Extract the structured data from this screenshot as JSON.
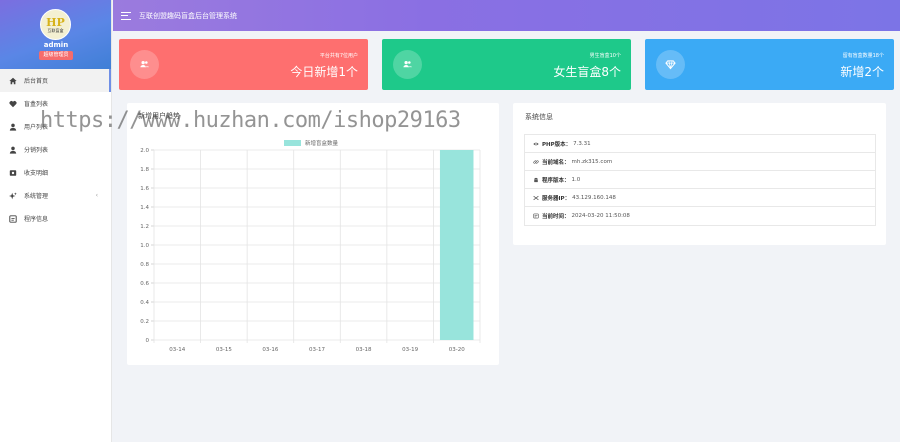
{
  "sidebar": {
    "avatar": {
      "logo_big": "HP",
      "logo_small": "互联盲盒"
    },
    "username": "admin",
    "role": "超级管理员",
    "items": [
      {
        "label": "后台首页",
        "icon": "home-icon"
      },
      {
        "label": "盲盒列表",
        "icon": "heart-icon"
      },
      {
        "label": "用户列表",
        "icon": "user-icon"
      },
      {
        "label": "分销列表",
        "icon": "user-icon"
      },
      {
        "label": "收支明细",
        "icon": "wallet-icon"
      },
      {
        "label": "系统管理",
        "icon": "sparkle-icon",
        "arrow": "‹"
      },
      {
        "label": "程序信息",
        "icon": "info-icon"
      }
    ]
  },
  "header": {
    "title": "互联创盟趣码盲盒后台管理系统"
  },
  "cards": [
    {
      "small": "平台共有7位用户",
      "big": "今日新增1个",
      "icon": "users-icon",
      "color": "#fe6f6f"
    },
    {
      "small": "男生盲盒10个",
      "big": "女生盲盒8个",
      "icon": "users-icon",
      "color": "#1ec98a"
    },
    {
      "small": "留有盲盒数量18个",
      "big": "新增2个",
      "icon": "diamond-icon",
      "color": "#3baaf5"
    }
  ],
  "chart_panel": {
    "title": "新增用户趋势"
  },
  "chart_data": {
    "type": "bar",
    "categories": [
      "03-14",
      "03-15",
      "03-16",
      "03-17",
      "03-18",
      "03-19",
      "03-20"
    ],
    "series": [
      {
        "name": "新增盲盒数量",
        "values": [
          0,
          0,
          0,
          0,
          0,
          0,
          2
        ],
        "color": "#98e4dc"
      }
    ],
    "ylim": [
      0,
      2.0
    ],
    "yticks": [
      "0",
      "0.2",
      "0.4",
      "0.6",
      "0.8",
      "1.0",
      "1.2",
      "1.4",
      "1.6",
      "1.8",
      "2.0"
    ],
    "legend": "top",
    "grid": true
  },
  "info_panel": {
    "title": "系统信息",
    "rows": [
      {
        "label": "PHP版本：",
        "value": "7.3.31",
        "icon": "eye-icon"
      },
      {
        "label": "当前域名：",
        "value": "mh.zk315.com",
        "icon": "link-icon"
      },
      {
        "label": "程序版本：",
        "value": "1.0",
        "icon": "android-icon"
      },
      {
        "label": "服务器IP：",
        "value": "43.129.160.148",
        "icon": "network-icon"
      },
      {
        "label": "当前时间：",
        "value": "2024-03-20 11:50:08",
        "icon": "clock-icon"
      }
    ]
  },
  "watermark": "https://www.huzhan.com/ishop29163"
}
